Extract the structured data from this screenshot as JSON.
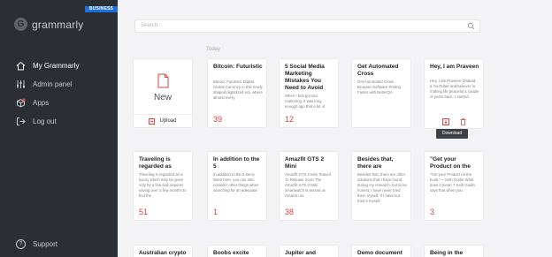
{
  "sidebar": {
    "badge": "BUSINESS",
    "logo_text": "grammarly",
    "items": [
      {
        "label": "My Grammarly",
        "icon": "home-icon",
        "active": true
      },
      {
        "label": "Admin panel",
        "icon": "sliders-icon",
        "active": false
      },
      {
        "label": "Apps",
        "icon": "box-icon",
        "active": false
      },
      {
        "label": "Log out",
        "icon": "logout-icon",
        "active": false
      }
    ],
    "support": "Support"
  },
  "search": {
    "placeholder": "Search..."
  },
  "section_label": "Today",
  "new_card": {
    "label": "New",
    "upload": "Upload"
  },
  "tooltip": "Download",
  "row1": [
    {
      "title": "Bitcoin: Futuristic",
      "preview": "Bitcoin: Futuristic Digital Global Currency In this newly shaped digitalized era, where almost every",
      "score": "39"
    },
    {
      "title": "5 Social Media Marketing Mistakes You Need to Avoid",
      "preview": "When I first got into marketing, it was long enough ago that a lot of",
      "score": "12"
    },
    {
      "title": "Get Automated Cross",
      "preview": "Get Automated Cross Browser-Software Testing Faster with BetterQA",
      "score": ""
    },
    {
      "title": "Hey, I am Praveen",
      "preview": "Hey, I am Praveen Dhakad, a YouTuber and believer in making life peaceful a couple of years back. I started",
      "score": ""
    }
  ],
  "row2": [
    {
      "title": "Traveling is regarded as",
      "preview": "Traveling is regarded as a luxury which may be given only by a few and requires saving over a few months to find the",
      "score": "51"
    },
    {
      "title": "In addition to the 5",
      "preview": "In addition to the 5 items listed here, you can also consider other things when searching for an adequate",
      "score": "1"
    },
    {
      "title": "Amazfit GTS 2 Mini",
      "preview": "Amazfit GTS 2 Mini Teased To Release Soon The Amazfit GTS 2 Mini smartwatch is teased on Amazon as",
      "score": "38"
    },
    {
      "title": "Besides that, there are",
      "preview": "Besides that, there are other solutions that I have found during my research, but to be honest, I have never tried them myself. If I have not tried it myself.",
      "score": ""
    },
    {
      "title": "\"Get your Product on the",
      "preview": "\"Get your Product on the hook.\" – Seth Godin What does it mean ? Seth Godin says that when you",
      "score": "3"
    }
  ],
  "row3": [
    {
      "title": "Australian crypto"
    },
    {
      "title": "Boobs excite"
    },
    {
      "title": "Jupiter and"
    },
    {
      "title": "Demo document"
    },
    {
      "title": "Being in the"
    }
  ]
}
